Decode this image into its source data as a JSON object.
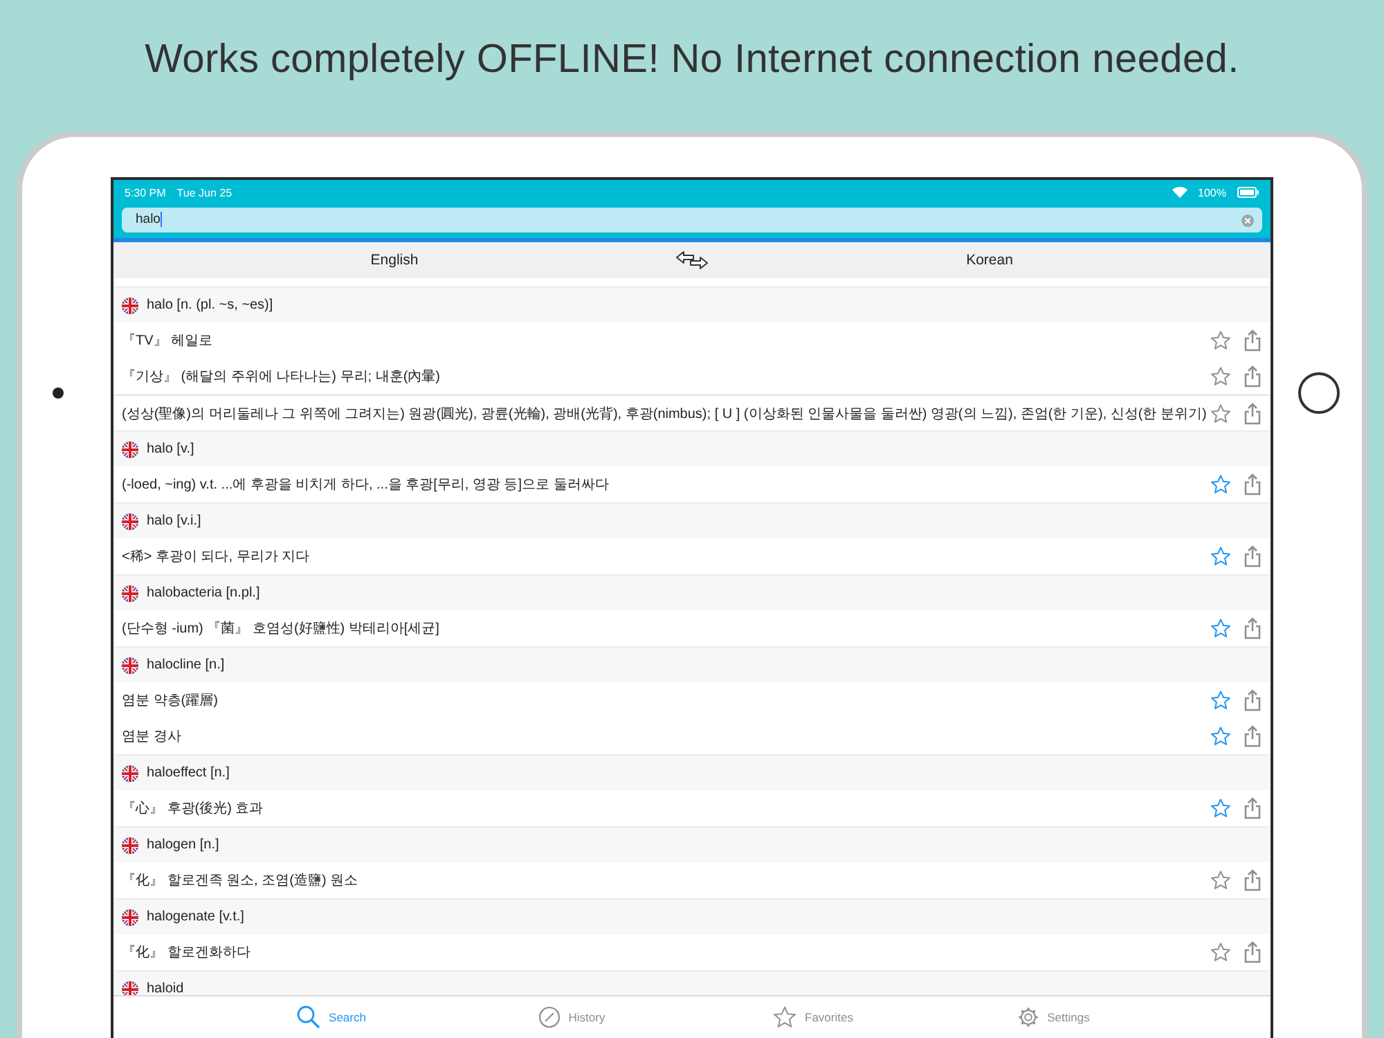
{
  "headline": "Works completely OFFLINE! No Internet connection needed.",
  "status_bar": {
    "time": "5:30 PM",
    "date": "Tue Jun 25",
    "battery": "100%"
  },
  "search": {
    "value": "halo"
  },
  "languages": {
    "source": "English",
    "target": "Korean"
  },
  "entries": [
    {
      "headword": "halo [n. (pl. ~s, ~es)]",
      "senses": [
        {
          "text": "『TV』 헤일로",
          "starred": false,
          "divider_before": false
        },
        {
          "text": "『기상』 (해달의 주위에 나타나는) 무리; 내훈(內暈)",
          "starred": false,
          "divider_before": false
        },
        {
          "text": "(성상(聖像)의 머리둘레나 그 위쪽에 그려지는) 원광(圓光), 광륜(光輪), 광배(光背), 후광(nimbus); [ U ] (이상화된 인물사물을 둘러싼) 영광(의 느낌), 존엄(한 기운), 신성(한 분위기)",
          "starred": false,
          "divider_before": true
        }
      ]
    },
    {
      "headword": "halo [v.]",
      "senses": [
        {
          "text": "(-loed, ~ing) v.t. ...에 후광을 비치게 하다, ...을 후광[무리, 영광 등]으로 둘러싸다",
          "starred": true,
          "divider_before": false
        }
      ]
    },
    {
      "headword": "halo [v.i.]",
      "senses": [
        {
          "text": "<稀> 후광이 되다, 무리가 지다",
          "starred": true,
          "divider_before": false
        }
      ]
    },
    {
      "headword": "halobacteria [n.pl.]",
      "senses": [
        {
          "text": "(단수형 -ium) 『菌』 호염성(好鹽性) 박테리아[세균]",
          "starred": true,
          "divider_before": false
        }
      ]
    },
    {
      "headword": "halocline [n.]",
      "senses": [
        {
          "text": "염분 약층(躍層)",
          "starred": true,
          "divider_before": false
        },
        {
          "text": "염분 경사",
          "starred": true,
          "divider_before": false
        }
      ]
    },
    {
      "headword": "haloeffect [n.]",
      "senses": [
        {
          "text": "『心』 후광(後光) 효과",
          "starred": true,
          "divider_before": false
        }
      ]
    },
    {
      "headword": "halogen [n.]",
      "senses": [
        {
          "text": "『化』 할로겐족 원소, 조염(造鹽) 원소",
          "starred": false,
          "divider_before": false
        }
      ]
    },
    {
      "headword": "halogenate [v.t.]",
      "senses": [
        {
          "text": "『化』 할로겐화하다",
          "starred": false,
          "divider_before": false
        }
      ]
    },
    {
      "headword": "haloid"
    }
  ],
  "tabs": [
    {
      "kind": "search",
      "label": "Search",
      "selected": true
    },
    {
      "kind": "history",
      "label": "History",
      "selected": false
    },
    {
      "kind": "favorites",
      "label": "Favorites",
      "selected": false
    },
    {
      "kind": "settings",
      "label": "Settings",
      "selected": false
    }
  ]
}
